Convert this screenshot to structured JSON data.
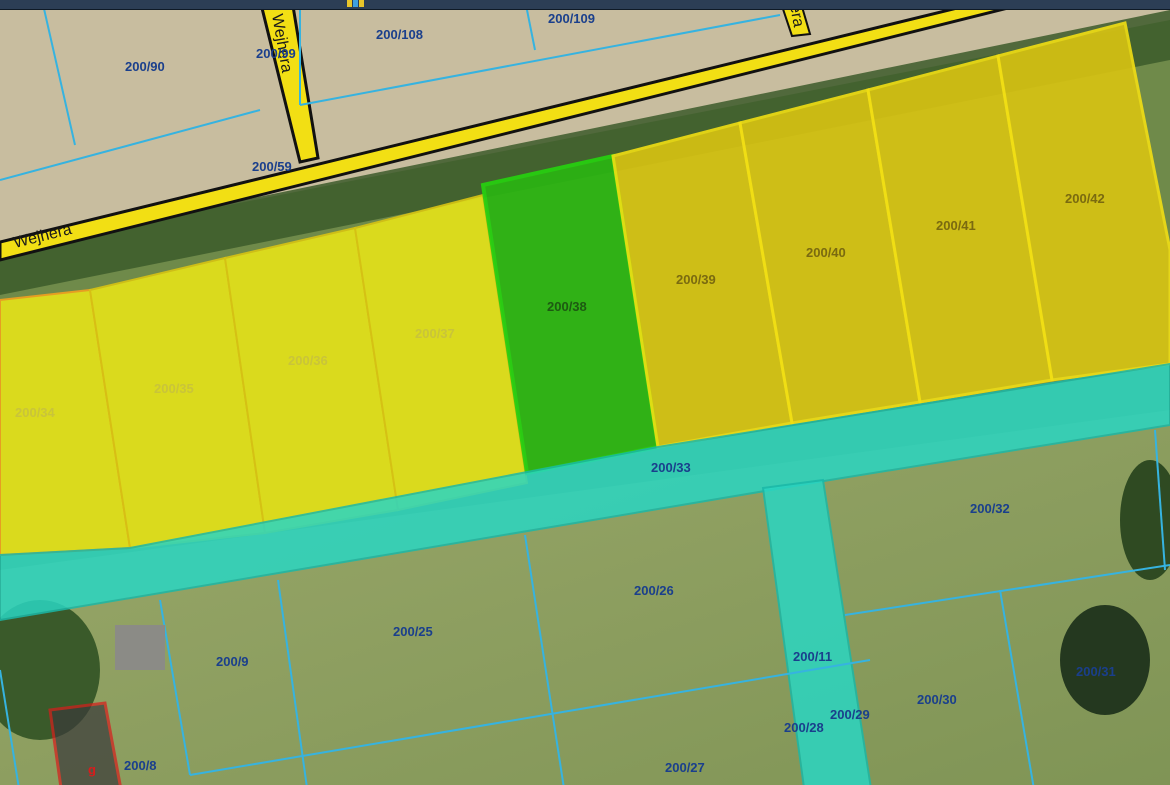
{
  "map": {
    "streets": [
      {
        "label": "Wejhera"
      },
      {
        "label": "Wejhera"
      },
      {
        "label": "era"
      }
    ],
    "parcels": [
      {
        "label": "200/90"
      },
      {
        "label": "200/99"
      },
      {
        "label": "200/108"
      },
      {
        "label": "200/109"
      },
      {
        "label": "200/59"
      },
      {
        "label": "200/34"
      },
      {
        "label": "200/35"
      },
      {
        "label": "200/36"
      },
      {
        "label": "200/37"
      },
      {
        "label": "200/38"
      },
      {
        "label": "200/39"
      },
      {
        "label": "200/40"
      },
      {
        "label": "200/41"
      },
      {
        "label": "200/42"
      },
      {
        "label": "200/33"
      },
      {
        "label": "200/32"
      },
      {
        "label": "200/26"
      },
      {
        "label": "200/25"
      },
      {
        "label": "200/9"
      },
      {
        "label": "200/11"
      },
      {
        "label": "200/31"
      },
      {
        "label": "200/30"
      },
      {
        "label": "200/29"
      },
      {
        "label": "200/28"
      },
      {
        "label": "200/27"
      },
      {
        "label": "200/8"
      }
    ],
    "building_marker": "g",
    "colors": {
      "road": "#f2df14",
      "selected_parcel": "#2bb512",
      "plot_yellow": "#e3e11a",
      "plot_ochre": "#d9c412",
      "path_cyan": "#2ad6c2",
      "boundary_lines": "#36b3e0",
      "building_outline": "#d81c1c",
      "label_text": "#1a3f8c"
    },
    "icons": [
      "layer-swatch-icon"
    ]
  }
}
